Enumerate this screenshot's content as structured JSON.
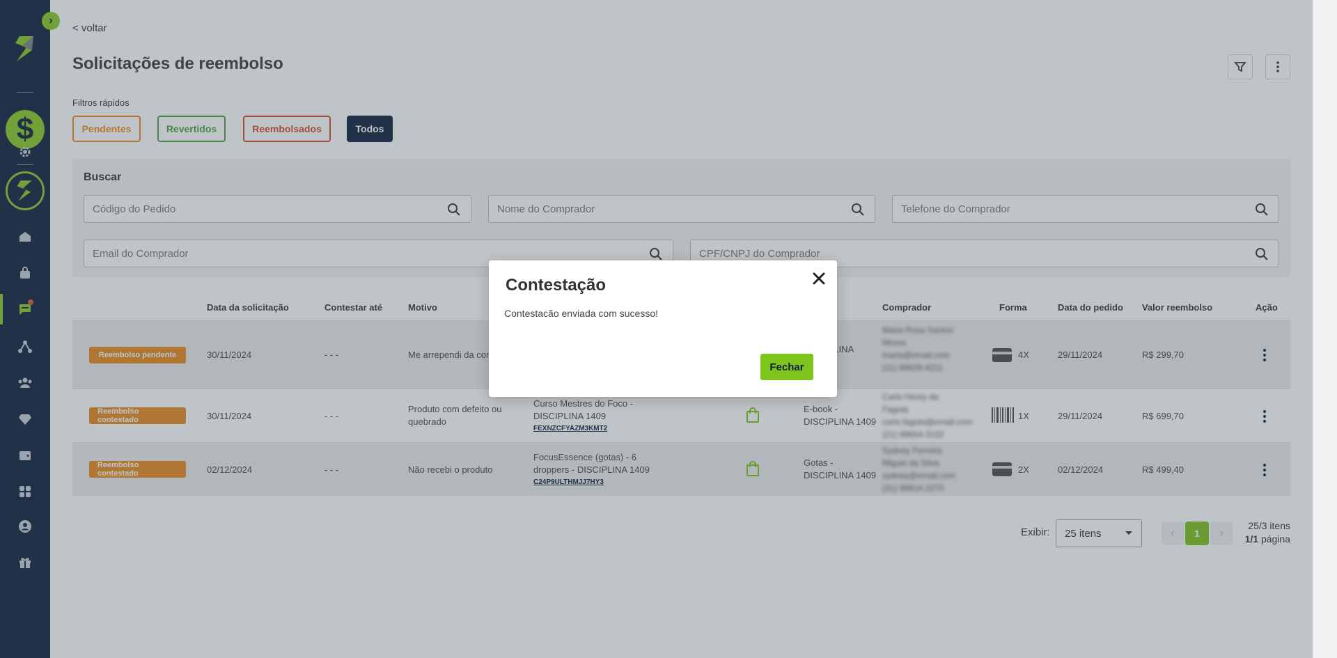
{
  "nav": {
    "back_label": "< voltar",
    "title": "Solicitações de reembolso"
  },
  "filters": {
    "quick_label": "Filtros rápidos",
    "chips": [
      {
        "label": "Pendentes",
        "color": "#e8891c"
      },
      {
        "label": "Revertidos",
        "color": "#4a9e3f"
      },
      {
        "label": "Reembolsados",
        "color": "#d04a2a"
      },
      {
        "label": "Todos",
        "color": "#0f1f3d"
      }
    ]
  },
  "search": {
    "title": "Buscar",
    "fields": {
      "order_code": "Código do Pedido",
      "buyer_name": "Nome do Comprador",
      "buyer_phone": "Telefone do Comprador",
      "buyer_email": "Email do Comprador",
      "buyer_doc": "CPF/CNPJ do Comprador"
    }
  },
  "table": {
    "headers": {
      "request_date": "Data da solicitação",
      "contest_until": "Contestar até",
      "reason": "Motivo",
      "buyer": "Comprador",
      "method": "Forma",
      "order_date": "Data do pedido",
      "refund_value": "Valor reembolso",
      "action": "Ação"
    },
    "rows": [
      {
        "status": "Reembolso pendente",
        "request_date": "30/11/2024",
        "contest_until": "- - -",
        "reason": "Me arrependi da compra",
        "product": "",
        "code": "",
        "offer": "DISCIPLINA",
        "buyer": "Maria Rosa Santos Moura maria@email.com (11) 98829-4211",
        "method_icon": "credit-card-icon",
        "installments": "4X",
        "order_date": "29/11/2024",
        "refund_value": "R$ 299,70"
      },
      {
        "status": "Reembolso contestado",
        "request_date": "30/11/2024",
        "contest_until": "- - -",
        "reason": "Produto com defeito ou quebrado",
        "product": "Curso Mestres do Foco - DISCIPLINA 1409",
        "code": "FEXNZCFYAZM3KMT2",
        "offer": "E-book - DISCIPLINA 1409",
        "buyer": "Carlo Henry da Fagota carlo.fagota@email.com (21) 99654-3102",
        "method_icon": "barcode-icon",
        "installments": "1X",
        "order_date": "29/11/2024",
        "refund_value": "R$ 699,70"
      },
      {
        "status": "Reembolso contestado",
        "request_date": "02/12/2024",
        "contest_until": "- - -",
        "reason": "Não recebi o produto",
        "product": "FocusEssence (gotas) - 6 droppers - DISCIPLINA 1409",
        "code": "C24P9ULTHMJJ7HY3",
        "offer": "Gotas - DISCIPLINA 1409",
        "buyer": "Sydney Ferreira Miguel da Silva sydney@email.com (31) 98814-2270",
        "method_icon": "credit-card-icon",
        "installments": "2X",
        "order_date": "02/12/2024",
        "refund_value": "R$ 499,40"
      }
    ]
  },
  "pagination": {
    "show_label": "Exibir:",
    "per_page": "25 itens",
    "current_page": "1",
    "items_summary": "25/3 itens",
    "page_num": "1/1",
    "page_suffix": "página"
  },
  "modal": {
    "title": "Contestação",
    "message": "Contestacão enviada com sucesso!",
    "close_label": "Fechar"
  },
  "colors": {
    "sidebar": "#0f1f3d",
    "accent": "#8ac926",
    "status_orange": "#e8891c"
  }
}
